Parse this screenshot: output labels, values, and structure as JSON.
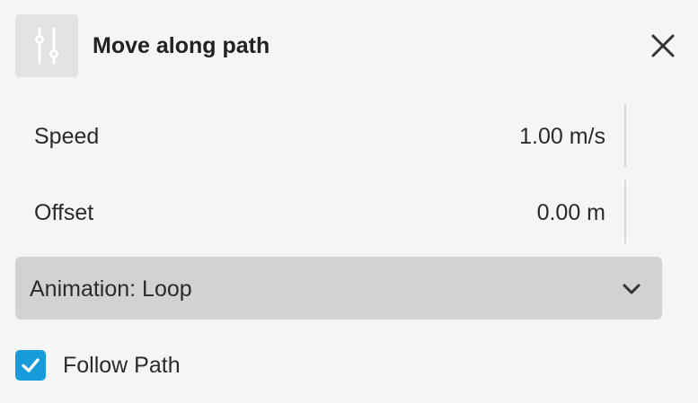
{
  "header": {
    "icon": "sliders-icon",
    "title": "Move along path",
    "close_icon": "close-icon"
  },
  "fields": [
    {
      "label": "Speed",
      "value": "1.00 m/s"
    },
    {
      "label": "Offset",
      "value": "0.00 m"
    }
  ],
  "animation": {
    "label": "Animation: Loop",
    "icon": "chevron-down-icon"
  },
  "follow_path": {
    "label": "Follow Path",
    "checked": true
  },
  "colors": {
    "background": "#f5f5f5",
    "icon_tile": "#e3e3e3",
    "dropdown": "#d2d2d2",
    "checkbox": "#179bdb"
  }
}
